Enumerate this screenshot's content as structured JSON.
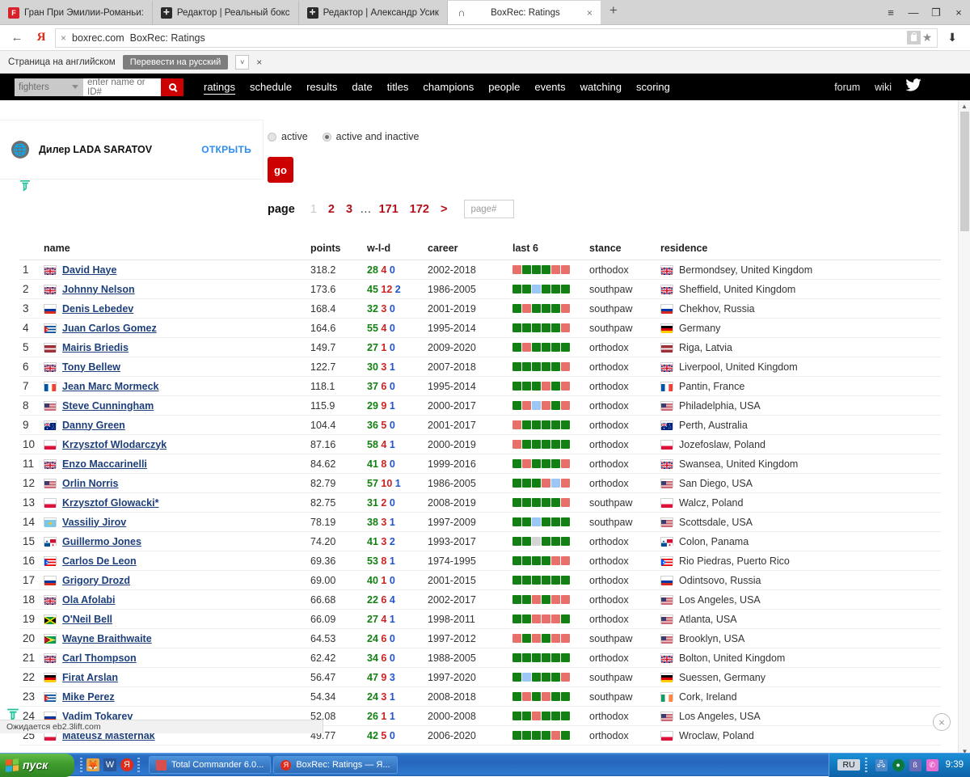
{
  "browser": {
    "tabs": [
      {
        "title": "Гран При Эмилии-Романьи:",
        "favicon": "red-f-icon",
        "active": false
      },
      {
        "title": "Редактор | Реальный бокс",
        "favicon": "plus-icon",
        "active": false
      },
      {
        "title": "Редактор | Александр Усик",
        "favicon": "plus-icon",
        "active": false
      },
      {
        "title": "BoxRec: Ratings",
        "favicon": "omega-icon",
        "active": true
      }
    ],
    "new_tab_label": "+",
    "window_controls": {
      "menu": "≡",
      "minimize": "—",
      "restore": "❐",
      "close": "×"
    },
    "address": {
      "back_label": "←",
      "brand": "Я",
      "stop_label": "×",
      "domain": "boxrec.com",
      "page_title": "BoxRec: Ratings",
      "download_label": "⬇"
    },
    "translate_bar": {
      "message": "Страница на английском",
      "button": "Перевести на русский",
      "caret": "˅",
      "close": "×"
    }
  },
  "sitenav": {
    "search_category": "fighters",
    "search_placeholder": "enter name or ID#",
    "search_icon": "search-icon",
    "links": [
      "ratings",
      "schedule",
      "results",
      "date",
      "titles",
      "champions",
      "people",
      "events",
      "watching",
      "scoring"
    ],
    "selected_link": "ratings",
    "right_links": [
      "forum",
      "wiki"
    ],
    "twitter_icon": "twitter-icon"
  },
  "advert": {
    "icon": "globe-icon",
    "text": "Дилер LADA SARATOV",
    "cta": "ОТКРЫТЬ",
    "mark_icon": "adfox-icon"
  },
  "filters": {
    "radios": [
      {
        "label": "active",
        "selected": false
      },
      {
        "label": "active and inactive",
        "selected": true
      }
    ],
    "go_label": "go"
  },
  "pagination": {
    "label": "page",
    "pages": [
      "1",
      "2",
      "3",
      "…",
      "171",
      "172",
      ">"
    ],
    "current": "1",
    "input_placeholder": "page#"
  },
  "status_bar": {
    "text": "Ожидается eb2.3lift.com"
  },
  "page_widgets": {
    "left_mark": "adfox-icon",
    "close_label": "×"
  },
  "table": {
    "columns": [
      "",
      "name",
      "points",
      "w-l-d",
      "career",
      "last 6",
      "stance",
      "residence"
    ],
    "rows": [
      {
        "rank": "1",
        "flag": "uk",
        "name": "David Haye",
        "points": "318.2",
        "w": "28",
        "l": "4",
        "d": "0",
        "career": "2002-2018",
        "last6": [
          "l",
          "w",
          "w",
          "w",
          "l",
          "l"
        ],
        "stance": "orthodox",
        "res_flag": "uk",
        "residence": "Bermondsey, United Kingdom"
      },
      {
        "rank": "2",
        "flag": "uk",
        "name": "Johnny Nelson",
        "points": "173.6",
        "w": "45",
        "l": "12",
        "d": "2",
        "career": "1986-2005",
        "last6": [
          "w",
          "w",
          "d",
          "w",
          "w",
          "w"
        ],
        "stance": "southpaw",
        "res_flag": "uk",
        "residence": "Sheffield, United Kingdom"
      },
      {
        "rank": "3",
        "flag": "ru",
        "name": "Denis Lebedev",
        "points": "168.4",
        "w": "32",
        "l": "3",
        "d": "0",
        "career": "2001-2019",
        "last6": [
          "w",
          "l",
          "w",
          "w",
          "w",
          "l"
        ],
        "stance": "southpaw",
        "res_flag": "ru",
        "residence": "Chekhov, Russia"
      },
      {
        "rank": "4",
        "flag": "cu",
        "name": "Juan Carlos Gomez",
        "points": "164.6",
        "w": "55",
        "l": "4",
        "d": "0",
        "career": "1995-2014",
        "last6": [
          "w",
          "w",
          "w",
          "w",
          "w",
          "l"
        ],
        "stance": "southpaw",
        "res_flag": "de",
        "residence": "Germany"
      },
      {
        "rank": "5",
        "flag": "lv",
        "name": "Mairis Briedis",
        "points": "149.7",
        "w": "27",
        "l": "1",
        "d": "0",
        "career": "2009-2020",
        "last6": [
          "w",
          "l",
          "w",
          "w",
          "w",
          "w"
        ],
        "stance": "orthodox",
        "res_flag": "lv",
        "residence": "Riga, Latvia"
      },
      {
        "rank": "6",
        "flag": "uk",
        "name": "Tony Bellew",
        "points": "122.7",
        "w": "30",
        "l": "3",
        "d": "1",
        "career": "2007-2018",
        "last6": [
          "w",
          "w",
          "w",
          "w",
          "w",
          "l"
        ],
        "stance": "orthodox",
        "res_flag": "uk",
        "residence": "Liverpool, United Kingdom"
      },
      {
        "rank": "7",
        "flag": "fr",
        "name": "Jean Marc Mormeck",
        "points": "118.1",
        "w": "37",
        "l": "6",
        "d": "0",
        "career": "1995-2014",
        "last6": [
          "w",
          "w",
          "w",
          "l",
          "w",
          "l"
        ],
        "stance": "orthodox",
        "res_flag": "fr",
        "residence": "Pantin, France"
      },
      {
        "rank": "8",
        "flag": "us",
        "name": "Steve Cunningham",
        "points": "115.9",
        "w": "29",
        "l": "9",
        "d": "1",
        "career": "2000-2017",
        "last6": [
          "w",
          "l",
          "d",
          "l",
          "w",
          "l"
        ],
        "stance": "orthodox",
        "res_flag": "us",
        "residence": "Philadelphia, USA"
      },
      {
        "rank": "9",
        "flag": "au",
        "name": "Danny Green",
        "points": "104.4",
        "w": "36",
        "l": "5",
        "d": "0",
        "career": "2001-2017",
        "last6": [
          "l",
          "w",
          "w",
          "w",
          "w",
          "w"
        ],
        "stance": "orthodox",
        "res_flag": "au",
        "residence": "Perth, Australia"
      },
      {
        "rank": "10",
        "flag": "pl",
        "name": "Krzysztof Wlodarczyk",
        "points": "87.16",
        "w": "58",
        "l": "4",
        "d": "1",
        "career": "2000-2019",
        "last6": [
          "l",
          "w",
          "w",
          "w",
          "w",
          "w"
        ],
        "stance": "orthodox",
        "res_flag": "pl",
        "residence": "Jozefoslaw, Poland"
      },
      {
        "rank": "11",
        "flag": "uk",
        "name": "Enzo Maccarinelli",
        "points": "84.62",
        "w": "41",
        "l": "8",
        "d": "0",
        "career": "1999-2016",
        "last6": [
          "w",
          "l",
          "w",
          "w",
          "w",
          "l"
        ],
        "stance": "orthodox",
        "res_flag": "uk",
        "residence": "Swansea, United Kingdom"
      },
      {
        "rank": "12",
        "flag": "us",
        "name": "Orlin Norris",
        "points": "82.79",
        "w": "57",
        "l": "10",
        "d": "1",
        "career": "1986-2005",
        "last6": [
          "w",
          "w",
          "w",
          "l",
          "d",
          "l"
        ],
        "stance": "orthodox",
        "res_flag": "us",
        "residence": "San Diego, USA"
      },
      {
        "rank": "13",
        "flag": "pl",
        "name": "Krzysztof Glowacki*",
        "points": "82.75",
        "w": "31",
        "l": "2",
        "d": "0",
        "career": "2008-2019",
        "last6": [
          "w",
          "w",
          "w",
          "w",
          "w",
          "l"
        ],
        "stance": "southpaw",
        "res_flag": "pl",
        "residence": "Walcz, Poland"
      },
      {
        "rank": "14",
        "flag": "kz",
        "name": "Vassiliy Jirov",
        "points": "78.19",
        "w": "38",
        "l": "3",
        "d": "1",
        "career": "1997-2009",
        "last6": [
          "w",
          "w",
          "d",
          "w",
          "w",
          "w"
        ],
        "stance": "southpaw",
        "res_flag": "us",
        "residence": "Scottsdale, USA"
      },
      {
        "rank": "15",
        "flag": "pa",
        "name": "Guillermo Jones",
        "points": "74.20",
        "w": "41",
        "l": "3",
        "d": "2",
        "career": "1993-2017",
        "last6": [
          "w",
          "w",
          "n",
          "w",
          "w",
          "w"
        ],
        "stance": "orthodox",
        "res_flag": "pa",
        "residence": "Colon, Panama"
      },
      {
        "rank": "16",
        "flag": "pr",
        "name": "Carlos De Leon",
        "points": "69.36",
        "w": "53",
        "l": "8",
        "d": "1",
        "career": "1974-1995",
        "last6": [
          "w",
          "w",
          "w",
          "w",
          "l",
          "l"
        ],
        "stance": "orthodox",
        "res_flag": "pr",
        "residence": "Rio Piedras, Puerto Rico"
      },
      {
        "rank": "17",
        "flag": "ru",
        "name": "Grigory Drozd",
        "points": "69.00",
        "w": "40",
        "l": "1",
        "d": "0",
        "career": "2001-2015",
        "last6": [
          "w",
          "w",
          "w",
          "w",
          "w",
          "w"
        ],
        "stance": "orthodox",
        "res_flag": "ru",
        "residence": "Odintsovo, Russia"
      },
      {
        "rank": "18",
        "flag": "uk",
        "name": "Ola Afolabi",
        "points": "66.68",
        "w": "22",
        "l": "6",
        "d": "4",
        "career": "2002-2017",
        "last6": [
          "w",
          "w",
          "l",
          "w",
          "l",
          "l"
        ],
        "stance": "orthodox",
        "res_flag": "us",
        "residence": "Los Angeles, USA"
      },
      {
        "rank": "19",
        "flag": "jm",
        "name": "O'Neil Bell",
        "points": "66.09",
        "w": "27",
        "l": "4",
        "d": "1",
        "career": "1998-2011",
        "last6": [
          "w",
          "w",
          "l",
          "l",
          "l",
          "w"
        ],
        "stance": "orthodox",
        "res_flag": "us",
        "residence": "Atlanta, USA"
      },
      {
        "rank": "20",
        "flag": "gy",
        "name": "Wayne Braithwaite",
        "points": "64.53",
        "w": "24",
        "l": "6",
        "d": "0",
        "career": "1997-2012",
        "last6": [
          "l",
          "w",
          "l",
          "w",
          "l",
          "l"
        ],
        "stance": "southpaw",
        "res_flag": "us",
        "residence": "Brooklyn, USA"
      },
      {
        "rank": "21",
        "flag": "uk",
        "name": "Carl Thompson",
        "points": "62.42",
        "w": "34",
        "l": "6",
        "d": "0",
        "career": "1988-2005",
        "last6": [
          "w",
          "w",
          "w",
          "w",
          "w",
          "w"
        ],
        "stance": "orthodox",
        "res_flag": "uk",
        "residence": "Bolton, United Kingdom"
      },
      {
        "rank": "22",
        "flag": "de",
        "name": "Firat Arslan",
        "points": "56.47",
        "w": "47",
        "l": "9",
        "d": "3",
        "career": "1997-2020",
        "last6": [
          "w",
          "d",
          "w",
          "w",
          "w",
          "l"
        ],
        "stance": "southpaw",
        "res_flag": "de",
        "residence": "Suessen, Germany"
      },
      {
        "rank": "23",
        "flag": "cu",
        "name": "Mike Perez",
        "points": "54.34",
        "w": "24",
        "l": "3",
        "d": "1",
        "career": "2008-2018",
        "last6": [
          "w",
          "l",
          "w",
          "l",
          "w",
          "w"
        ],
        "stance": "southpaw",
        "res_flag": "ie",
        "residence": "Cork, Ireland"
      },
      {
        "rank": "24",
        "flag": "ru",
        "name": "Vadim Tokarev",
        "points": "52.08",
        "w": "26",
        "l": "1",
        "d": "1",
        "career": "2000-2008",
        "last6": [
          "w",
          "w",
          "l",
          "w",
          "w",
          "w"
        ],
        "stance": "orthodox",
        "res_flag": "us",
        "residence": "Los Angeles, USA"
      },
      {
        "rank": "25",
        "flag": "pl",
        "name": "Mateusz Masternak",
        "points": "49.77",
        "w": "42",
        "l": "5",
        "d": "0",
        "career": "2006-2020",
        "last6": [
          "w",
          "w",
          "w",
          "w",
          "l",
          "w"
        ],
        "stance": "orthodox",
        "res_flag": "pl",
        "residence": "Wroclaw, Poland"
      }
    ]
  },
  "taskbar": {
    "start_label": "пуск",
    "quick_icons": [
      "browser-icon",
      "word-icon",
      "yandex-icon"
    ],
    "tasks": [
      {
        "label": "Total Commander 6.0...",
        "icon": "floppy-icon"
      },
      {
        "label": "BoxRec: Ratings — Я...",
        "icon": "yandex-icon"
      }
    ],
    "tray": {
      "language": "RU",
      "icons": [
        "network-icon",
        "antivirus-icon",
        "bluetooth-icon",
        "messenger-icon"
      ],
      "clock": "9:39"
    }
  },
  "colors": {
    "accent_red": "#cc0000",
    "link_blue": "#1d3f7a",
    "win_green": "#128012",
    "loss_red": "#cc2222",
    "draw_blue": "#2255cc",
    "nav_black": "#000000"
  }
}
